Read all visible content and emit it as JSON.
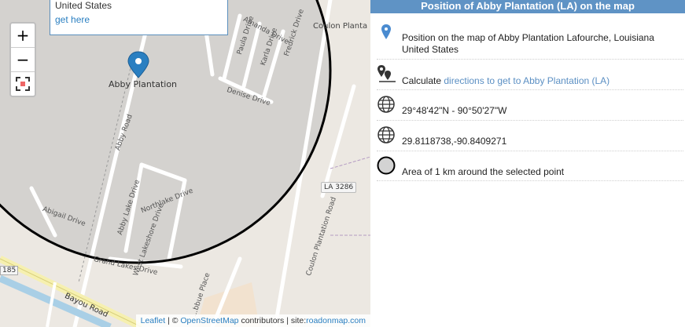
{
  "header": {
    "title": "Position of Abby Plantation (LA) on the map"
  },
  "popup": {
    "country": "United States",
    "link": "get here"
  },
  "zoom": {
    "in": "+",
    "out": "−"
  },
  "map_labels": {
    "place": "Abby Plantation",
    "coulon_top": "Coulon Planta",
    "amanda": "Amanda Drive",
    "paula": "Paula Drive",
    "karla": "Karla Drive",
    "fredrick": "Fredrick Drive",
    "denise": "Denise Drive",
    "abby_road": "Abby Road",
    "abigail": "Abigail Drive",
    "abby_lake": "Abby Lake Drive",
    "northlake": "Northlake Drive",
    "west_lakeshore": "West Lakeshore Drive",
    "grand_lakes": "Grand Lakes Drive",
    "coulon_road": "Coulon Plantation Road",
    "la3286": "LA 3286",
    "bayou": "Bayou Road",
    "route185": "185",
    "place_road": "...bbue Place"
  },
  "attribution": {
    "leaflet": "Leaflet",
    "sep": "| ©",
    "osm": "OpenStreetMap",
    "contrib": "contributors | site:",
    "site": "roadonmap.com"
  },
  "info": {
    "position_text": "Position on the map of Abby Plantation Lafourche, Louisiana United States",
    "calc_prefix": "Calculate",
    "calc_link": "directions to get to Abby Plantation (LA)",
    "dms": "29°48'42\"N - 90°50'27\"W",
    "decimal": "29.8118738,-90.8409271",
    "area": "Area of 1 km around the selected point"
  },
  "icons": {
    "position": "map-pin-icon",
    "directions": "directions-icon",
    "globe": "globe-icon",
    "circle": "circle-icon"
  },
  "colors": {
    "header": "#5f93c5",
    "link": "#5b8fc3",
    "marker": "#2a7fc1"
  }
}
